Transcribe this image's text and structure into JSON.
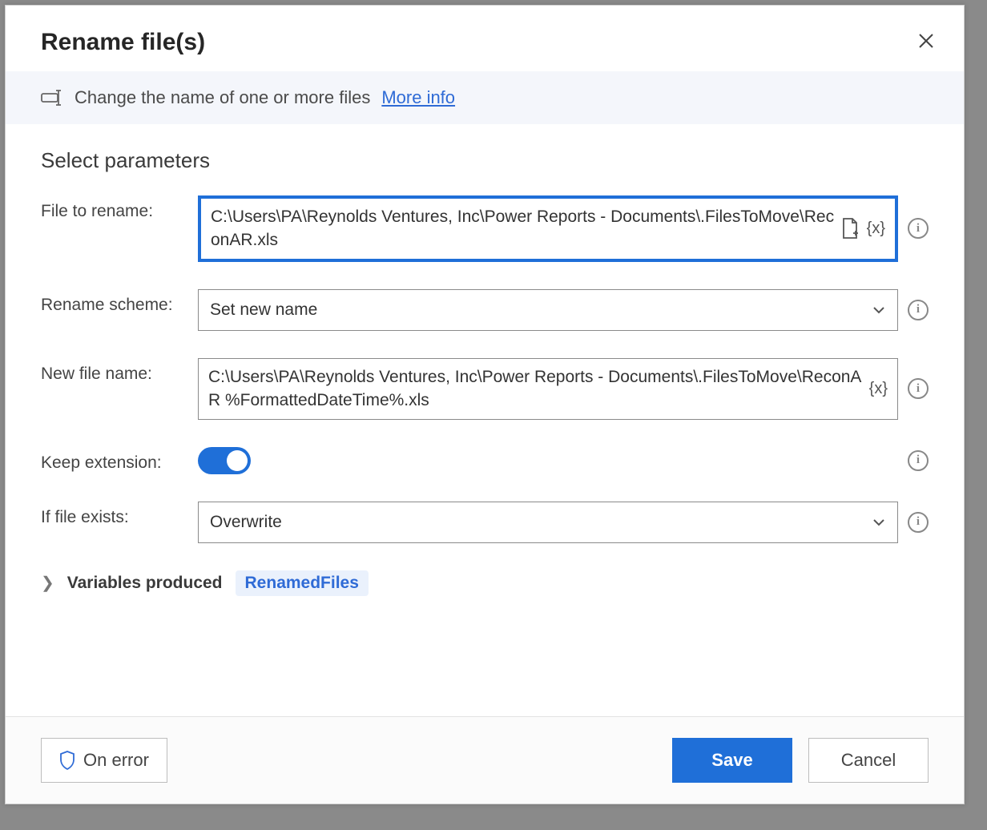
{
  "dialog": {
    "title": "Rename file(s)",
    "description": "Change the name of one or more files",
    "more_info": "More info"
  },
  "section": {
    "title": "Select parameters"
  },
  "fields": {
    "file_to_rename": {
      "label": "File to rename:",
      "value": "C:\\Users\\PA\\Reynolds Ventures, Inc\\Power Reports - Documents\\.FilesToMove\\ReconAR.xls"
    },
    "rename_scheme": {
      "label": "Rename scheme:",
      "value": "Set new name"
    },
    "new_file_name": {
      "label": "New file name:",
      "value": "C:\\Users\\PA\\Reynolds Ventures, Inc\\Power Reports - Documents\\.FilesToMove\\ReconAR %FormattedDateTime%.xls"
    },
    "keep_extension": {
      "label": "Keep extension:",
      "value": true
    },
    "if_file_exists": {
      "label": "If file exists:",
      "value": "Overwrite"
    }
  },
  "variables": {
    "label": "Variables produced",
    "items": [
      "RenamedFiles"
    ]
  },
  "footer": {
    "on_error": "On error",
    "save": "Save",
    "cancel": "Cancel"
  },
  "icons": {
    "var_token": "{x}",
    "info": "i"
  }
}
